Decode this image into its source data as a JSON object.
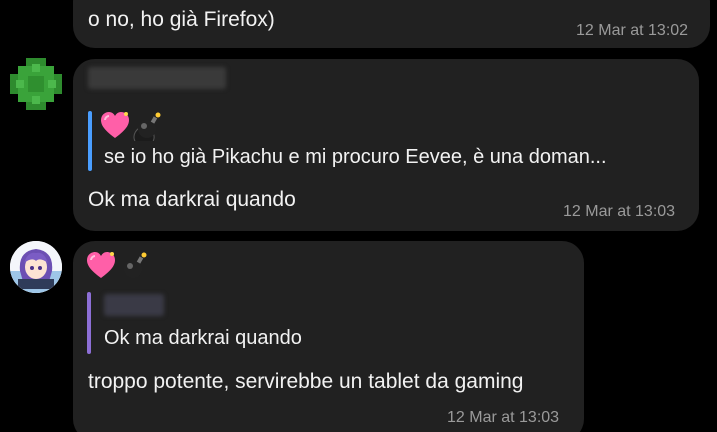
{
  "colors": {
    "background": "#000000",
    "bubble": "#212121",
    "text": "#f2f2f2",
    "timestamp": "#9a9a9a",
    "reply_bar_1": "#4a9eff",
    "reply_bar_2": "#8d6fd6"
  },
  "messages": [
    {
      "text": "o no, ho già Firefox)",
      "time": "12 Mar at 13:02"
    },
    {
      "reactions": [
        "sparkling-heart-icon",
        "bomb-icon"
      ],
      "reply_quote": "se io ho già Pikachu e mi procuro Eevee, è una doman...",
      "text": "Ok ma darkrai quando",
      "time": "12 Mar at 13:03"
    },
    {
      "reactions": [
        "sparkling-heart-icon",
        "bomb-icon"
      ],
      "reply_quote": "Ok ma darkrai quando",
      "text": "troppo potente, servirebbe un tablet da gaming",
      "time": "12 Mar at 13:03"
    }
  ],
  "icons": {
    "avatar_1": "pixelated-avatar",
    "avatar_2": "anime-avatar"
  }
}
